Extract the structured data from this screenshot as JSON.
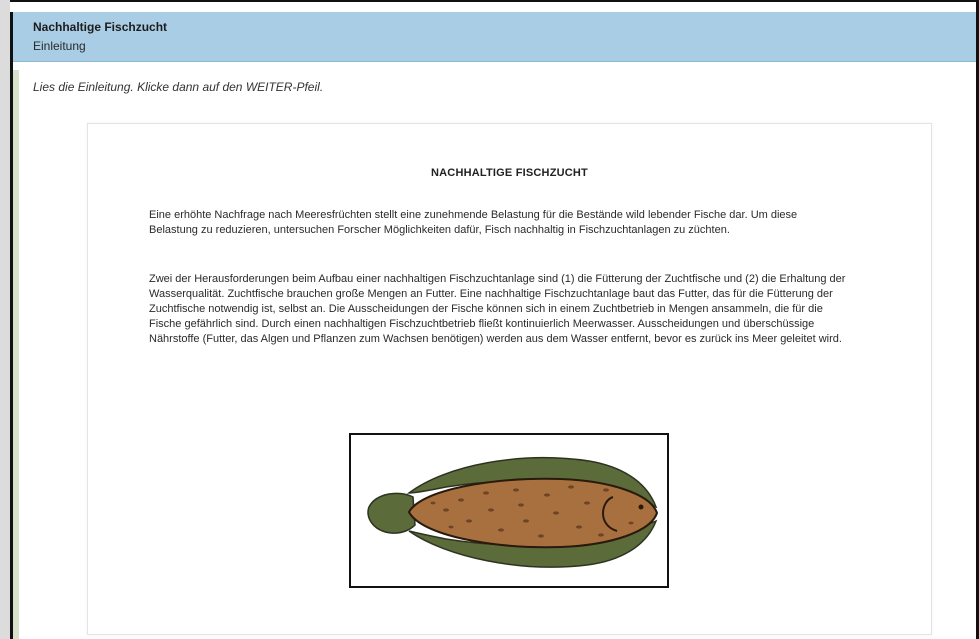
{
  "header": {
    "title": "Nachhaltige Fischzucht",
    "subtitle": "Einleitung"
  },
  "instruction": "Lies die Einleitung. Klicke dann auf den WEITER-Pfeil.",
  "article": {
    "heading": "NACHHALTIGE FISCHZUCHT",
    "paragraph1": "Eine erhöhte Nachfrage nach Meeresfrüchten stellt eine zunehmende Belastung für die Bestände wild lebender Fische dar. Um diese Belastung zu reduzieren, untersuchen Forscher Möglichkeiten dafür, Fisch nachhaltig in Fischzuchtanlagen zu züchten.",
    "paragraph2": "Zwei der Herausforderungen beim Aufbau einer nachhaltigen Fischzuchtanlage sind (1) die Fütterung der Zuchtfische und (2) die Erhaltung der Wasserqualität. Zuchtfische brauchen große Mengen an Futter. Eine nachhaltige Fischzuchtanlage baut das Futter, das für die Fütterung der Zuchtfische notwendig ist, selbst an. Die Ausscheidungen der Fische können sich in einem Zuchtbetrieb in Mengen ansammeln, die für die Fische gefährlich sind. Durch einen nachhaltigen Fischzuchtbetrieb fließt kontinuierlich Meerwasser. Ausscheidungen und überschüssige Nährstoffe (Futter, das Algen und Pflanzen zum Wachsen benötigen) werden aus dem Wasser entfernt, bevor es zurück ins Meer geleitet wird."
  },
  "colors": {
    "header_bg": "#a9cde5",
    "fish_body": "#a9703f",
    "fish_fin": "#5b6b3a",
    "fish_spots": "#6e4326"
  },
  "icons": {
    "figure": "flatfish-illustration"
  }
}
